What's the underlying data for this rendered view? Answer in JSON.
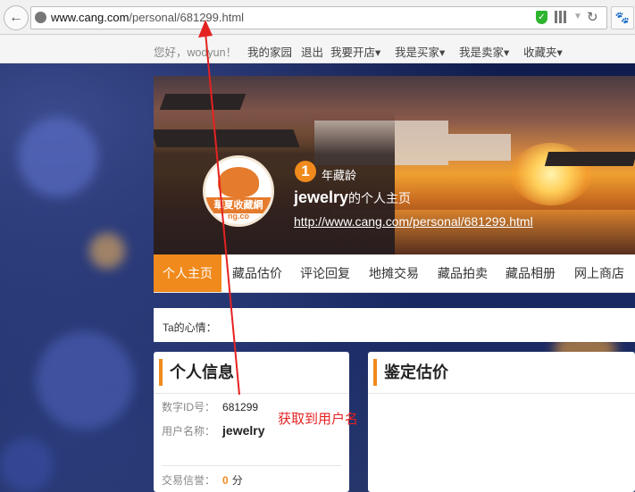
{
  "browser": {
    "url_domain": "www.cang.com",
    "url_path": "/personal/681299.html",
    "back_glyph": "←",
    "reload_glyph": "↻",
    "ext_glyph": "🐾"
  },
  "topnav": {
    "greeting": "您好，wodyun！",
    "items": [
      "我的家园",
      "退出",
      "我要开店▾",
      "我是买家▾",
      "我是卖家▾",
      "收藏夹▾"
    ]
  },
  "banner": {
    "logo_band": "華夏收藏網",
    "logo_sub": "ng.co",
    "age_number": "1",
    "age_label": "年藏龄",
    "username": "jewelry",
    "username_suffix": "的个人主页",
    "home_url": "http://www.cang.com/personal/681299.html"
  },
  "tabs": [
    "个人主页",
    "藏品估价",
    "评论回复",
    "地摊交易",
    "藏品拍卖",
    "藏品相册",
    "网上商店"
  ],
  "mood_label": "Ta的心情：",
  "personal_info": {
    "title": "个人信息",
    "id_label": "数字ID号：",
    "id_value": "681299",
    "name_label": "用户名称：",
    "name_value": "jewelry",
    "credit_label": "交易信誉：",
    "credit_value": "0",
    "credit_unit": "分"
  },
  "appraisal": {
    "title": "鉴定估价"
  },
  "annotation": {
    "text": "获取到用户名",
    "color": "#e52222"
  },
  "colors": {
    "accent": "#f08a1c",
    "annotation": "#e52222"
  }
}
